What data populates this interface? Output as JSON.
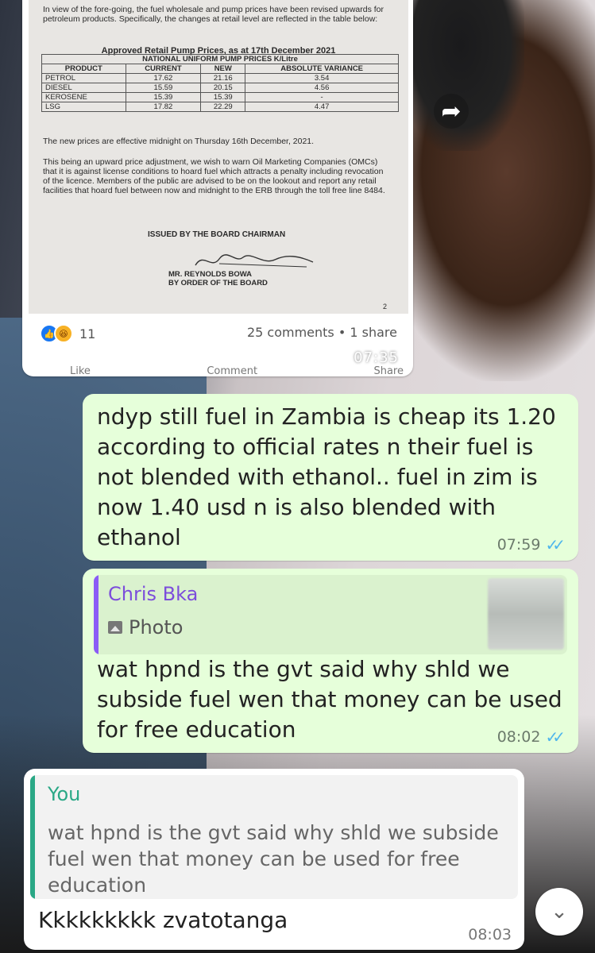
{
  "forwarded_post": {
    "doc": {
      "intro": "In view of the fore-going, the fuel wholesale and pump prices have been revised upwards for petroleum products. Specifically, the changes at retail level are reflected in the table below:",
      "table_title": "Approved Retail Pump Prices, as at 17th December 2021",
      "table_subtitle": "NATIONAL UNIFORM PUMP PRICES K/Litre",
      "columns": [
        "PRODUCT",
        "CURRENT",
        "NEW",
        "ABSOLUTE VARIANCE"
      ],
      "rows": [
        [
          "PETROL",
          "17.62",
          "21.16",
          "3.54"
        ],
        [
          "DIESEL",
          "15.59",
          "20.15",
          "4.56"
        ],
        [
          "KEROSENE",
          "15.39",
          "15.39",
          "-"
        ],
        [
          "LSG",
          "17.82",
          "22.29",
          "4.47"
        ]
      ],
      "effective": "The new prices are effective midnight on Thursday 16th December, 2021.",
      "warning": "This being an upward price adjustment, we wish to warn Oil Marketing Companies (OMCs) that it is against license conditions to hoard fuel which attracts a penalty including revocation of the licence. Members of the public are advised to be on the lookout and report any retail facilities that hoard fuel between now and midnight to the ERB through the toll free line 8484.",
      "issued_by": "ISSUED BY THE BOARD CHAIRMAN",
      "signatory_name": "MR. REYNOLDS BOWA",
      "signatory_role": "BY ORDER OF THE BOARD",
      "page_number": "2"
    },
    "reaction_count": "11",
    "comments_share": "25 comments • 1 share",
    "time": "07:35",
    "actions": [
      "Like",
      "Comment",
      "Share"
    ]
  },
  "messages": [
    {
      "text": "ndyp still fuel in Zambia is cheap its 1.20 according to official rates n their fuel is not blended with ethanol.. fuel in zim is now 1.40 usd n is also blended with ethanol",
      "time": "07:59"
    },
    {
      "quote_author": "Chris Bka",
      "quote_type": "Photo",
      "text": "wat hpnd is the gvt said why shld we subside fuel wen that money can be used for free education",
      "time": "08:02"
    },
    {
      "quote_author": "You",
      "quote_text": "wat hpnd is the gvt said why shld we subside fuel wen that money can be used for free education",
      "text": "Kkkkkkkkk zvatotanga",
      "time": "08:03"
    }
  ],
  "colors": {
    "outgoing_bubble": "#e6ffda",
    "incoming_bubble": "#ffffff",
    "read_ticks": "#4fb6ec",
    "quote_purple": "#7c4ddb",
    "quote_green": "#2aa886"
  }
}
